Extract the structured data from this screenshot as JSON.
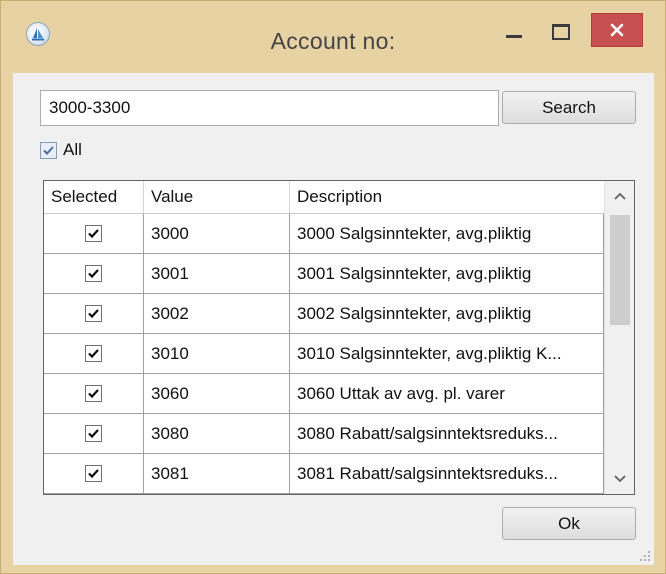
{
  "window": {
    "title": "Account no:",
    "app_icon": "sailboat-icon",
    "controls": [
      "minimize-icon",
      "maximize-icon",
      "close-icon"
    ],
    "close_color": "#c75050"
  },
  "search": {
    "value": "3000-3300",
    "button_label": "Search"
  },
  "filter": {
    "all_label": "All",
    "all_checked": true
  },
  "grid": {
    "columns": [
      "Selected",
      "Value",
      "Description"
    ],
    "rows": [
      {
        "selected": true,
        "value": "3000",
        "description": "3000 Salgsinntekter, avg.pliktig"
      },
      {
        "selected": true,
        "value": "3001",
        "description": "3001 Salgsinntekter, avg.pliktig"
      },
      {
        "selected": true,
        "value": "3002",
        "description": "3002 Salgsinntekter, avg.pliktig"
      },
      {
        "selected": true,
        "value": "3010",
        "description": "3010 Salgsinntekter, avg.pliktig K..."
      },
      {
        "selected": true,
        "value": "3060",
        "description": "3060 Uttak av avg. pl. varer"
      },
      {
        "selected": true,
        "value": "3080",
        "description": "3080 Rabatt/salgsinntektsreduks..."
      },
      {
        "selected": true,
        "value": "3081",
        "description": "3081 Rabatt/salgsinntektsreduks..."
      }
    ]
  },
  "footer": {
    "ok_label": "Ok"
  }
}
